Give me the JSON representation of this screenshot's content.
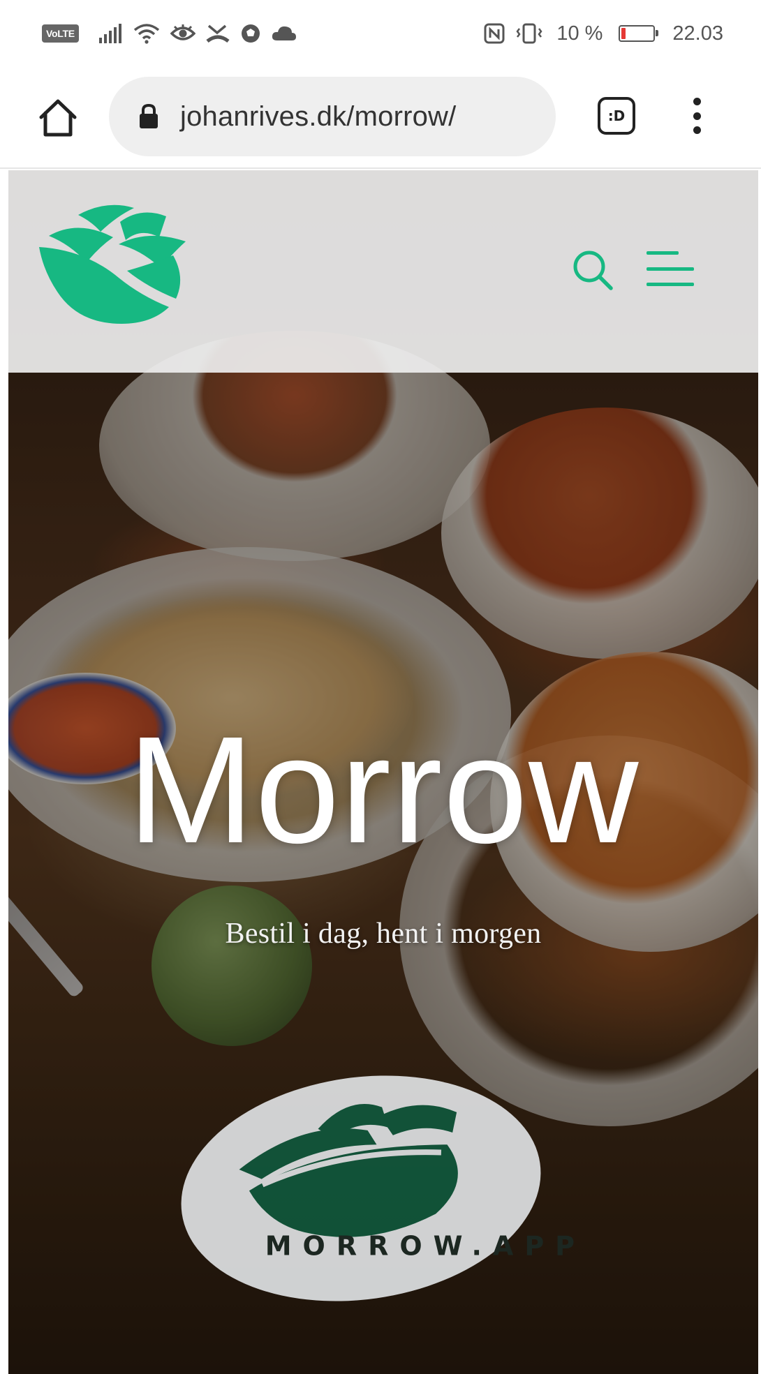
{
  "status_bar": {
    "network_badge": "VoLTE",
    "battery_percent": "10 %",
    "battery_level": 0.1,
    "time": "22.03",
    "icons": [
      "volte-icon",
      "signal-icon",
      "wifi-icon",
      "eye-icon",
      "missed-call-icon",
      "football-icon",
      "cloud-icon",
      "nfc-icon",
      "vibrate-icon",
      "battery-icon"
    ]
  },
  "browser": {
    "url": "johanrives.dk/morrow/",
    "tab_switcher_label": ":D",
    "icons": [
      "home-icon",
      "lock-icon",
      "tab-switcher-icon",
      "more-vert-icon"
    ]
  },
  "site": {
    "brand_color": "#17b882",
    "header_icons": [
      "morrow-logo",
      "search-icon",
      "menu-icon"
    ],
    "hero_title": "Morrow",
    "hero_subtitle": "Bestil i dag, hent i morgen",
    "coaster_text": "MORROW.APP"
  }
}
